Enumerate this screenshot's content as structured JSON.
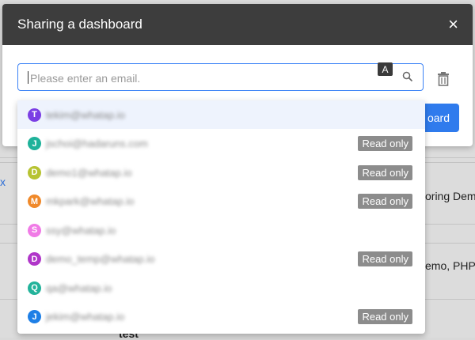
{
  "modal": {
    "title": "Sharing a dashboard",
    "close_label": "×",
    "search_placeholder": "Please enter an email.",
    "input_badge": "A",
    "share_button_label": "oard"
  },
  "background": {
    "text_1": "oring Demo",
    "text_2": "emo, PHP",
    "text_3": "test"
  },
  "read_only_label": "Read only",
  "suggestions": [
    {
      "initial": "T",
      "color": "#7b3fe4",
      "email": "tekim@whatap.io",
      "read_only": false,
      "active": true
    },
    {
      "initial": "J",
      "color": "#1fb29a",
      "email": "jschoi@hadaruns.com",
      "read_only": true,
      "active": false
    },
    {
      "initial": "D",
      "color": "#b7c332",
      "email": "demo1@whatap.io",
      "read_only": true,
      "active": false
    },
    {
      "initial": "M",
      "color": "#f0892a",
      "email": "mkpark@whatap.io",
      "read_only": true,
      "active": false
    },
    {
      "initial": "S",
      "color": "#f07be6",
      "email": "ssy@whatap.io",
      "read_only": false,
      "active": false
    },
    {
      "initial": "D",
      "color": "#b036c9",
      "email": "demo_temp@whatap.io",
      "read_only": true,
      "active": false
    },
    {
      "initial": "Q",
      "color": "#23b39b",
      "email": "qa@whatap.io",
      "read_only": false,
      "active": false
    },
    {
      "initial": "J",
      "color": "#1e7fe6",
      "email": "jekim@whatap.io",
      "read_only": true,
      "active": false
    }
  ]
}
